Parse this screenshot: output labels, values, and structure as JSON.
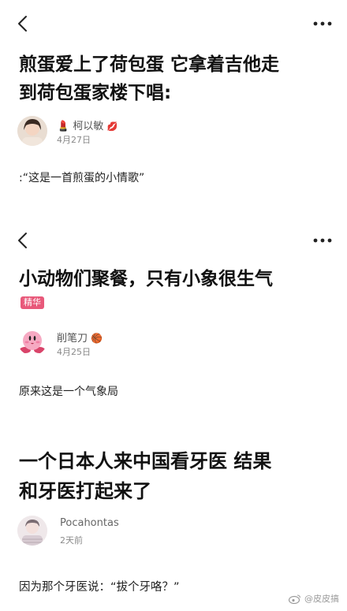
{
  "posts": [
    {
      "title_line1": "煎蛋爱上了荷包蛋 它拿着吉他走",
      "title_line2": "到荷包蛋家楼下唱:",
      "author": "柯以敏",
      "author_prefix_emoji": "💄",
      "author_suffix_emoji": "💋",
      "date": "4月27日",
      "body": ":“这是一首煎蛋的小情歌”"
    },
    {
      "title_line1": "小动物们聚餐，只有小象很生气",
      "badge": "精华",
      "author": "削笔刀",
      "author_suffix_emoji": "🏀",
      "date": "4月25日",
      "body": "原来这是一个气象局"
    },
    {
      "title_line1": "一个日本人来中国看牙医 结果",
      "title_line2": "和牙医打起来了",
      "author": "Pocahontas",
      "date": "2天前",
      "body": "因为那个牙医说：“拔个牙咯？”"
    }
  ],
  "watermark": "@皮皮搞"
}
